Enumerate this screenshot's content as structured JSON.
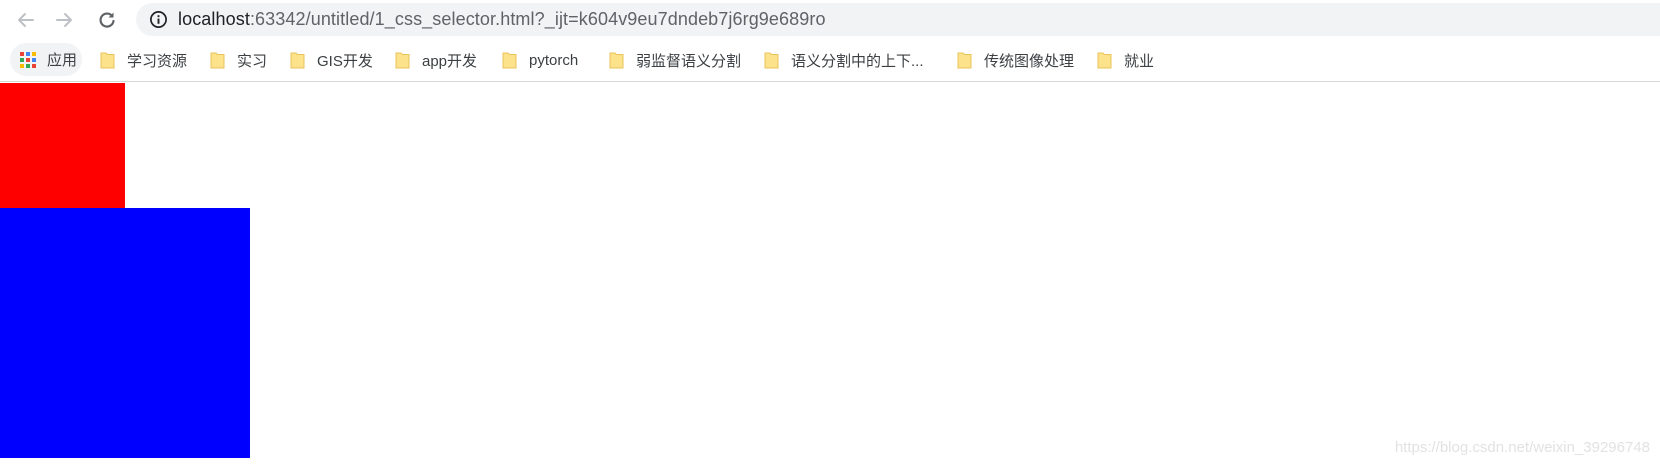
{
  "toolbar": {
    "back_icon": "arrow-left-icon",
    "forward_icon": "arrow-right-icon",
    "reload_icon": "reload-icon",
    "site_info_icon": "info-icon",
    "url_host": "localhost",
    "url_rest": ":63342/untitled/1_css_selector.html?_ijt=k604v9eu7dndeb7j6rg9e689ro"
  },
  "bookmarks": {
    "apps_label": "应用",
    "items": [
      {
        "label": "学习资源"
      },
      {
        "label": "实习"
      },
      {
        "label": "GIS开发"
      },
      {
        "label": "app开发"
      },
      {
        "label": "pytorch"
      },
      {
        "label": "弱监督语义分割"
      },
      {
        "label": "语义分割中的上下..."
      },
      {
        "label": "传统图像处理"
      },
      {
        "label": "就业"
      }
    ]
  },
  "page": {
    "box1_color": "#ff0000",
    "box2_color": "#0000ff",
    "watermark": "https://blog.csdn.net/weixin_39296748"
  },
  "colors": {
    "omnibox_bg": "#f1f3f4",
    "folder_fill": "#fce28a",
    "folder_stroke": "#e8c35a"
  }
}
